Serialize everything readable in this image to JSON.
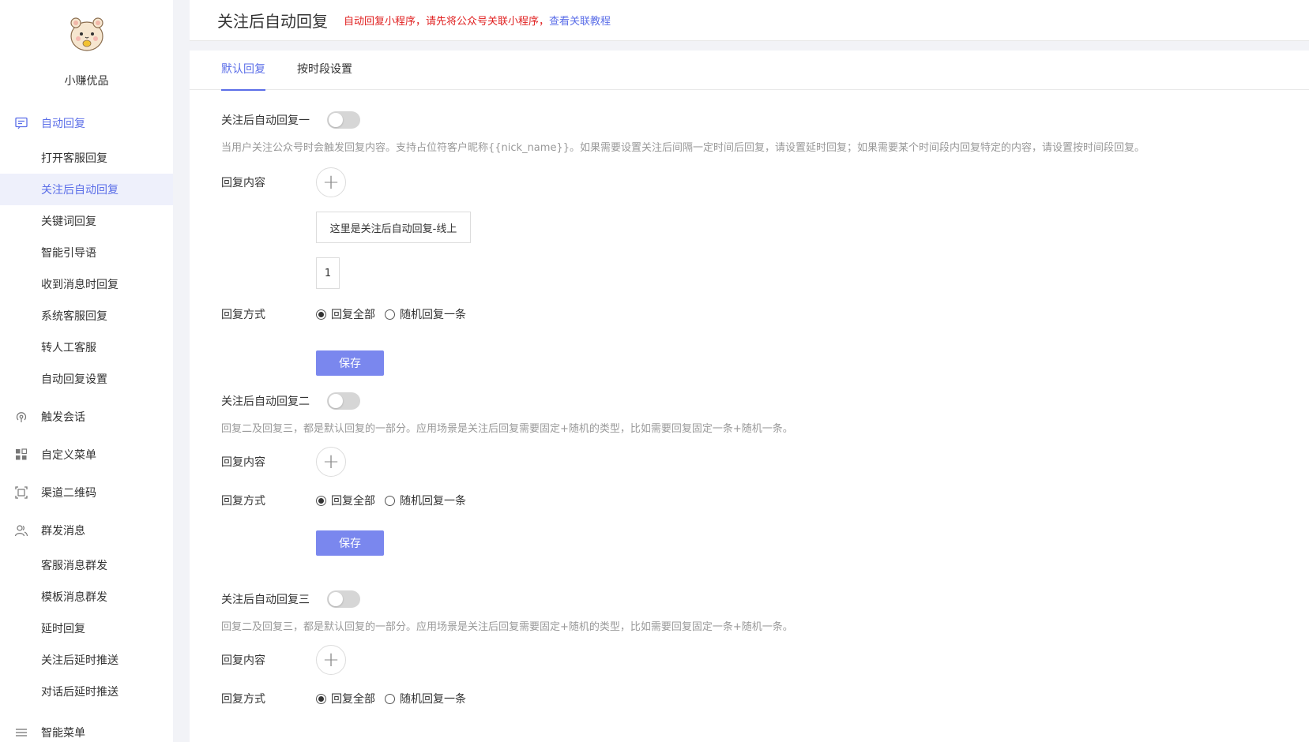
{
  "sidebar": {
    "brand_name": "小赚优品",
    "section_auto_reply": "自动回复",
    "auto_reply_items": [
      "打开客服回复",
      "关注后自动回复",
      "关键词回复",
      "智能引导语",
      "收到消息时回复",
      "系统客服回复",
      "转人工客服",
      "自动回复设置"
    ],
    "section_trigger": "触发会话",
    "section_custom_menu": "自定义菜单",
    "section_qrcode": "渠道二维码",
    "section_broadcast": "群发消息",
    "broadcast_items": [
      "客服消息群发",
      "模板消息群发",
      "延时回复",
      "关注后延时推送",
      "对话后延时推送"
    ],
    "section_smart_menu": "智能菜单"
  },
  "header": {
    "title": "关注后自动回复",
    "warning": "自动回复小程序，请先将公众号关联小程序，",
    "link": "查看关联教程"
  },
  "tabs": [
    "默认回复",
    "按时段设置"
  ],
  "labels": {
    "reply_content": "回复内容",
    "reply_mode": "回复方式",
    "reply_all": "回复全部",
    "reply_random": "随机回复一条",
    "save": "保存"
  },
  "blocks": [
    {
      "title": "关注后自动回复一",
      "desc": "当用户关注公众号时会触发回复内容。支持占位符客户昵称{{nick_name}}。如果需要设置关注后间隔一定时间后回复，请设置延时回复；如果需要某个时间段内回复特定的内容，请设置按时间段回复。",
      "card_text": "这里是关注后自动回复-线上",
      "card_count": "1"
    },
    {
      "title": "关注后自动回复二",
      "desc": "回复二及回复三，都是默认回复的一部分。应用场景是关注后回复需要固定+随机的类型，比如需要回复固定一条+随机一条。"
    },
    {
      "title": "关注后自动回复三",
      "desc": "回复二及回复三，都是默认回复的一部分。应用场景是关注后回复需要固定+随机的类型，比如需要回复固定一条+随机一条。"
    }
  ],
  "colors": {
    "accent": "#5b6ee8",
    "button": "#7a87ee",
    "warning": "#e02020"
  }
}
